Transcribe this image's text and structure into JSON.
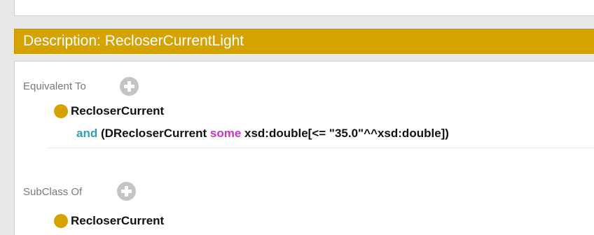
{
  "description": {
    "title": "Description: RecloserCurrentLight"
  },
  "equivalent_to": {
    "label": "Equivalent To",
    "class_name": "RecloserCurrent",
    "expression": {
      "and_kw": "and",
      "open": " (",
      "property": "DRecloserCurrent",
      "some_kw": "some",
      "restriction": " xsd:double[<= \"35.0\"^^xsd:double])"
    }
  },
  "subclass_of": {
    "label": "SubClass Of",
    "class_name": "RecloserCurrent"
  },
  "colors": {
    "header": "#d4a300",
    "class_dot": "#d4a300",
    "and_keyword": "#2aa3b8",
    "some_keyword": "#c833c8",
    "add_icon": "#c4c4c4"
  },
  "icons": {
    "add": "plus-circle-icon",
    "class": "class-dot-icon"
  }
}
